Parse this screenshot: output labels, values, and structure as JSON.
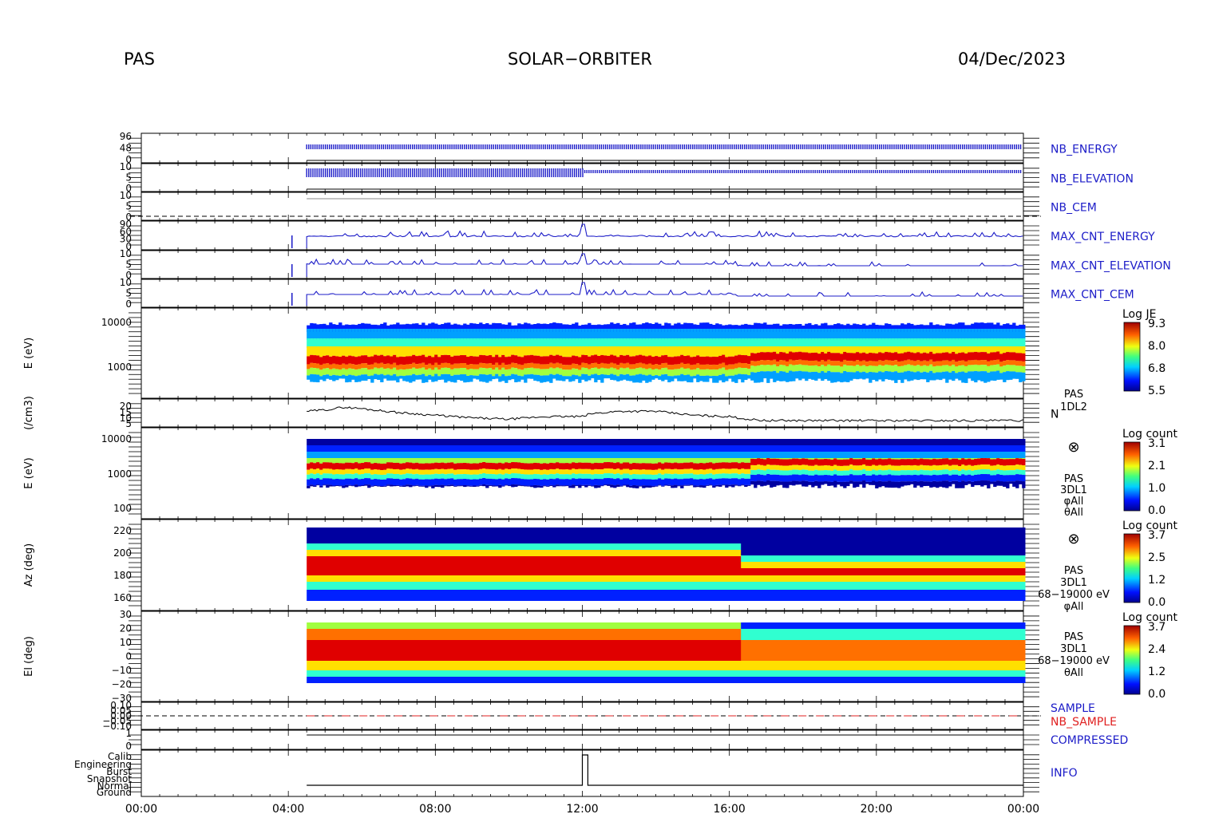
{
  "header": {
    "instrument": "PAS",
    "mission": "SOLAR−ORBITER",
    "date": "04/Dec/2023"
  },
  "colors": {
    "trace": "#1c1cc8",
    "black": "#000000",
    "red_label": "#e02020",
    "axis_label_blue": "#1c1cc8"
  },
  "chart_data": [
    {
      "type": "line",
      "panel": "nb_energy",
      "label": "NB_ENERGY",
      "y_ticks": [
        "96",
        "48",
        "0"
      ],
      "note": "dense periodic energy stepping from ~04:30 to 24:00, step change near 12:00"
    },
    {
      "type": "line",
      "panel": "nb_elevation",
      "label": "NB_ELEVATION",
      "y_ticks": [
        "10",
        "5",
        "0"
      ]
    },
    {
      "type": "line",
      "panel": "nb_cem",
      "label": "NB_CEM",
      "y_ticks": [
        "10",
        "5",
        "0"
      ]
    },
    {
      "type": "line",
      "panel": "max_cnt_energy",
      "label": "MAX_CNT_ENERGY",
      "y_ticks": [
        "90",
        "60",
        "30",
        "0"
      ]
    },
    {
      "type": "line",
      "panel": "max_cnt_elevation",
      "label": "MAX_CNT_ELEVATION",
      "y_ticks": [
        "10",
        "5",
        "0"
      ]
    },
    {
      "type": "line",
      "panel": "max_cnt_cem",
      "label": "MAX_CNT_CEM",
      "y_ticks": [
        "10",
        "5",
        "0"
      ]
    },
    {
      "type": "heatmap",
      "panel": "spec_1dl2",
      "ylabel": "E (eV)",
      "y_log": true,
      "y_ticks": [
        "10000",
        "1000"
      ],
      "side_labels": [
        "PAS",
        "1DL2"
      ],
      "colorbar": {
        "title": "Log JE",
        "ticks": [
          "9.3",
          "8.0",
          "6.8",
          "5.5"
        ]
      },
      "peak_energy_eV": {
        "x": [
          4.5,
          6,
          8,
          10,
          12,
          14,
          16,
          17,
          18,
          20,
          22,
          24
        ],
        "y": [
          1100,
          1050,
          1200,
          1300,
          1250,
          1300,
          1350,
          1700,
          1500,
          1400,
          1350,
          1400
        ]
      }
    },
    {
      "type": "line",
      "panel": "density",
      "ylabel": "(/cm3)",
      "y_ticks": [
        "20",
        "15",
        "10",
        "5"
      ],
      "side_label": "N",
      "x": [
        4.5,
        5,
        5.5,
        6,
        7,
        8,
        9,
        10,
        11,
        12,
        12.2,
        13,
        14,
        15,
        16,
        16.5,
        17,
        18,
        20,
        22,
        24
      ],
      "y": [
        15,
        16,
        18,
        17,
        14,
        12,
        10,
        9,
        11,
        11,
        13,
        15,
        15,
        12,
        11,
        9,
        8,
        8,
        8,
        8,
        8
      ]
    },
    {
      "type": "heatmap",
      "panel": "spec_3dl1_energy",
      "ylabel": "E (eV)",
      "y_log": true,
      "y_ticks": [
        "10000",
        "1000",
        "100"
      ],
      "side_labels": [
        "PAS",
        "3DL1",
        "φAll",
        "θAll"
      ],
      "colorbar": {
        "title": "Log count",
        "ticks": [
          "3.1",
          "2.1",
          "1.0",
          "0.0"
        ]
      }
    },
    {
      "type": "heatmap",
      "panel": "spec_3dl1_azimuth",
      "ylabel": "Az (deg)",
      "y_ticks": [
        "220",
        "200",
        "180",
        "160"
      ],
      "side_labels": [
        "PAS",
        "3DL1",
        "68−19000 eV",
        "φAll"
      ],
      "colorbar": {
        "title": "Log count",
        "ticks": [
          "3.7",
          "2.5",
          "1.2",
          "0.0"
        ]
      }
    },
    {
      "type": "heatmap",
      "panel": "spec_3dl1_elevation",
      "ylabel": "El (deg)",
      "y_ticks": [
        "30",
        "20",
        "10",
        "0",
        "−10",
        "−20",
        "−30"
      ],
      "side_labels": [
        "PAS",
        "3DL1",
        "68−19000 eV",
        "θAll"
      ],
      "colorbar": {
        "title": "Log count",
        "ticks": [
          "3.7",
          "2.4",
          "1.2",
          "0.0"
        ]
      }
    },
    {
      "type": "line",
      "panel": "sample",
      "labels": [
        "SAMPLE",
        "NB_SAMPLE"
      ],
      "y_ticks": [
        "0.10",
        "0.05",
        "0.00",
        "−0.05",
        "−0.10"
      ]
    },
    {
      "type": "line",
      "panel": "compressed",
      "label": "COMPRESSED",
      "y_ticks": [
        "1",
        "0"
      ]
    },
    {
      "type": "line",
      "panel": "info",
      "label": "INFO",
      "y_ticks": [
        "Calib",
        "Engineering",
        "Burst",
        "Snapshot",
        "Normal",
        "Ground"
      ]
    }
  ],
  "x_axis": {
    "ticks": [
      "00:00",
      "04:00",
      "08:00",
      "12:00",
      "16:00",
      "20:00",
      "00:00"
    ]
  }
}
